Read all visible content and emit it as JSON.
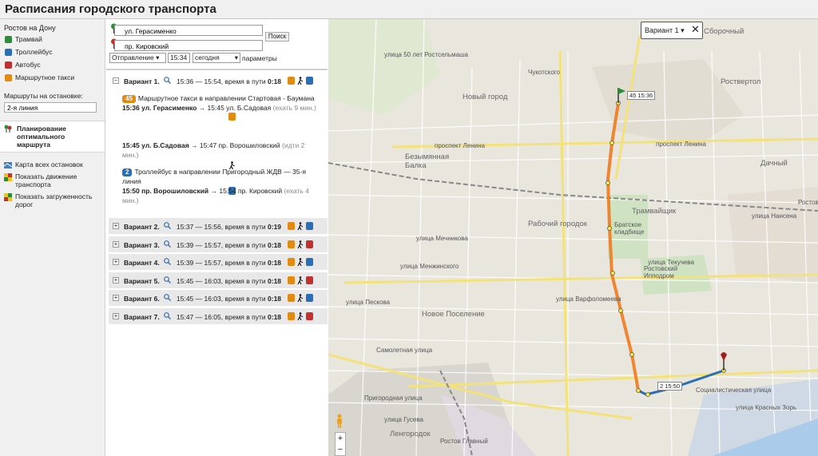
{
  "header": {
    "title": "Расписания городского транспорта"
  },
  "sidebar": {
    "city": "Ростов на Дону",
    "modes": [
      {
        "label": "Трамвай",
        "icon": "tram-icon",
        "color": "#2e8b3a"
      },
      {
        "label": "Троллейбус",
        "icon": "trolleybus-icon",
        "color": "#2a6fb5"
      },
      {
        "label": "Автобус",
        "icon": "bus-icon",
        "color": "#c43030"
      },
      {
        "label": "Маршрутное такси",
        "icon": "minibus-icon",
        "color": "#e38a10"
      }
    ],
    "stop_label": "Маршруты на остановке:",
    "stop_value": "2-я линия",
    "plan_label": "Планирование оптимального маршрута",
    "tools": [
      {
        "label": "Карта всех остановок",
        "icon": "map-icon"
      },
      {
        "label": "Показать движение транспорта",
        "icon": "traffic-icon"
      },
      {
        "label": "Показать загруженность дорог",
        "icon": "congestion-icon"
      }
    ]
  },
  "routing": {
    "from": "ул. Герасименко",
    "to": "пр. Кировский",
    "search_label": "Поиск",
    "mode": "Отправление",
    "time": "15:34",
    "day": "сегодня",
    "params": "параметры",
    "variants": [
      {
        "name": "Вариант 1.",
        "time": "15:36 — 15:54, время в пути",
        "duration": "0:18",
        "open": true,
        "segments": [
          {
            "type": "taxi",
            "badge": "45",
            "text": "Маршрутное такси в направлении Стартовая - Баумана",
            "from_time": "15:36 ул. Герасименко",
            "to_time": "→ 15:45 ул. Б.Садовая",
            "wait": "(ехать 9 мин.)"
          },
          {
            "type": "walk",
            "from_time": "15:45 ул. Б.Садовая",
            "to_time": "→ 15:47 пр. Ворошиловский",
            "wait": "(идти 2 мин.)"
          },
          {
            "type": "trolley",
            "badge": "2",
            "text": "Троллейбус в направлении Пригородный ЖДВ — 35-я линия",
            "from_time": "15:50 пр. Ворошиловский",
            "to_time": "→ 15:54 пр. Кировский",
            "wait": "(ехать 4 мин.)"
          }
        ]
      },
      {
        "name": "Вариант 2.",
        "time": "15:37 — 15:56, время в пути",
        "duration": "0:19"
      },
      {
        "name": "Вариант 3.",
        "time": "15:39 — 15:57, время в пути",
        "duration": "0:18"
      },
      {
        "name": "Вариант 4.",
        "time": "15:39 — 15:57, время в пути",
        "duration": "0:18"
      },
      {
        "name": "Вариант 5.",
        "time": "15:45 — 16:03, время в пути",
        "duration": "0:18"
      },
      {
        "name": "Вариант 6.",
        "time": "15:45 — 16:03, время в пути",
        "duration": "0:18"
      },
      {
        "name": "Вариант 7.",
        "time": "15:47 — 16:05, время в пути",
        "duration": "0:18"
      }
    ]
  },
  "map": {
    "variant_select": "Вариант 1",
    "close": "✕",
    "start_tag": "45  15:36",
    "transfer_tag": "2  15:50",
    "zoom_in": "+",
    "zoom_out": "−",
    "route_color": "#f07a1e",
    "labels": {
      "l1": "Новый город",
      "l2": "Безымянная Балка",
      "l3": "Рабочий городок",
      "l4": "Трамвайщик",
      "l5": "Новое Поселение",
      "l6": "Ленгородок",
      "l7": "Роствертол",
      "l8": "Дачный",
      "l9": "Сборочный",
      "l10": "проспект Ленина",
      "l11": "улица Варфоломеева",
      "l12": "улица Текучева",
      "l13": "Ростов Главный",
      "l14": "Чукотского",
      "l15": "Ростовский Ипподром",
      "l16": "улица Пескова",
      "l17": "улица Менжинского",
      "l18": "Братское кладбище",
      "l19": "Пригородная улица",
      "l20": "улица Гусева",
      "l21": "улица Мечникова",
      "l22": "улица 50 лет Ростсельмаша",
      "l23": "Самолетная улица",
      "l24": "Социалистическая улица",
      "l25": "улица Красных Зорь",
      "l26": "проспект Ленина",
      "l27": "улица Нансена",
      "l28": "Ростов"
    }
  }
}
